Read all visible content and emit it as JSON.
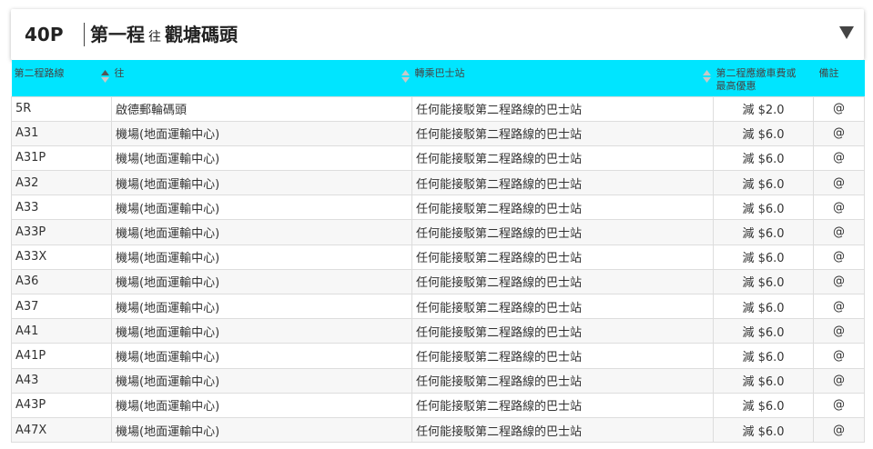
{
  "header": {
    "route_number": "40P",
    "first_leg": "第一程",
    "to_word": "往",
    "destination": "觀塘碼頭"
  },
  "table": {
    "columns": {
      "route": "第二程路線",
      "to": "往",
      "interchange": "轉乘巴士站",
      "discount_line1": "第二程應繳車費或",
      "discount_line2": "最高優惠",
      "remark": "備註"
    },
    "rows": [
      {
        "route": "5R",
        "to": "啟德郵輪碼頭",
        "interchange": "任何能接駁第二程路線的巴士站",
        "discount": "減 $2.0",
        "remark": "@"
      },
      {
        "route": "A31",
        "to": "機場(地面運輸中心)",
        "interchange": "任何能接駁第二程路線的巴士站",
        "discount": "減 $6.0",
        "remark": "@"
      },
      {
        "route": "A31P",
        "to": "機場(地面運輸中心)",
        "interchange": "任何能接駁第二程路線的巴士站",
        "discount": "減 $6.0",
        "remark": "@"
      },
      {
        "route": "A32",
        "to": "機場(地面運輸中心)",
        "interchange": "任何能接駁第二程路線的巴士站",
        "discount": "減 $6.0",
        "remark": "@"
      },
      {
        "route": "A33",
        "to": "機場(地面運輸中心)",
        "interchange": "任何能接駁第二程路線的巴士站",
        "discount": "減 $6.0",
        "remark": "@"
      },
      {
        "route": "A33P",
        "to": "機場(地面運輸中心)",
        "interchange": "任何能接駁第二程路線的巴士站",
        "discount": "減 $6.0",
        "remark": "@"
      },
      {
        "route": "A33X",
        "to": "機場(地面運輸中心)",
        "interchange": "任何能接駁第二程路線的巴士站",
        "discount": "減 $6.0",
        "remark": "@"
      },
      {
        "route": "A36",
        "to": "機場(地面運輸中心)",
        "interchange": "任何能接駁第二程路線的巴士站",
        "discount": "減 $6.0",
        "remark": "@"
      },
      {
        "route": "A37",
        "to": "機場(地面運輸中心)",
        "interchange": "任何能接駁第二程路線的巴士站",
        "discount": "減 $6.0",
        "remark": "@"
      },
      {
        "route": "A41",
        "to": "機場(地面運輸中心)",
        "interchange": "任何能接駁第二程路線的巴士站",
        "discount": "減 $6.0",
        "remark": "@"
      },
      {
        "route": "A41P",
        "to": "機場(地面運輸中心)",
        "interchange": "任何能接駁第二程路線的巴士站",
        "discount": "減 $6.0",
        "remark": "@"
      },
      {
        "route": "A43",
        "to": "機場(地面運輸中心)",
        "interchange": "任何能接駁第二程路線的巴士站",
        "discount": "減 $6.0",
        "remark": "@"
      },
      {
        "route": "A43P",
        "to": "機場(地面運輸中心)",
        "interchange": "任何能接駁第二程路線的巴士站",
        "discount": "減 $6.0",
        "remark": "@"
      },
      {
        "route": "A47X",
        "to": "機場(地面運輸中心)",
        "interchange": "任何能接駁第二程路線的巴士站",
        "discount": "減 $6.0",
        "remark": "@"
      }
    ]
  },
  "colors": {
    "header_band": "#00e5ff",
    "sort_active": "#555555",
    "sort_inactive": "#c8c8c8"
  },
  "sort": {
    "active_column": "route",
    "direction": "ascending"
  }
}
